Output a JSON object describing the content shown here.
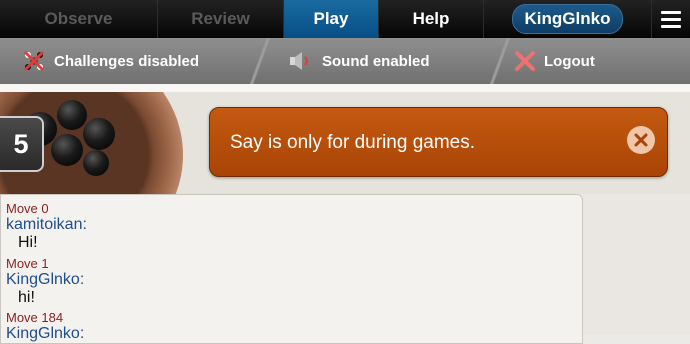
{
  "nav": {
    "tabs": [
      {
        "label": "Observe"
      },
      {
        "label": "Review"
      },
      {
        "label": "Play"
      },
      {
        "label": "Help"
      }
    ],
    "user": "KingGlnko"
  },
  "subbar": {
    "challenges": "Challenges disabled",
    "sound": "Sound enabled",
    "logout": "Logout"
  },
  "board": {
    "move_count": "5"
  },
  "toast": {
    "message": "Say is only for during games."
  },
  "chat": {
    "messages": [
      {
        "move": "Move 0",
        "author": "kamitoikan:",
        "text": "Hi!"
      },
      {
        "move": "Move 1",
        "author": "KingGlnko:",
        "text": "hi!"
      },
      {
        "move": "Move 184",
        "author": "KingGlnko:",
        "text": ""
      }
    ]
  },
  "colors": {
    "accent": "#0a5a93",
    "toast": "#b34c08",
    "move_label": "#8a1f1f",
    "author": "#1f4f8f"
  },
  "icons": [
    "challenge-disabled-icon",
    "speaker-icon",
    "logout-x-icon",
    "close-icon",
    "hamburger-icon"
  ]
}
